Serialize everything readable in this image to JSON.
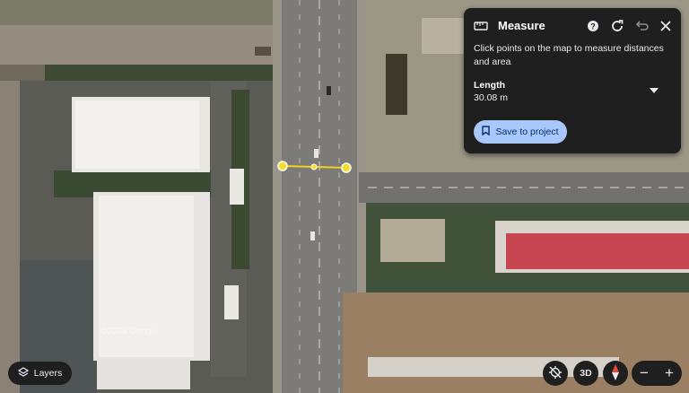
{
  "measure_panel": {
    "title": "Measure",
    "instructions": "Click points on the map to measure distances and area",
    "length_label": "Length",
    "length_value": "30.08 m",
    "save_label": "Save to project",
    "icons": [
      "ruler-icon",
      "help-icon",
      "refresh-icon",
      "undo-icon",
      "close-icon",
      "dropdown-arrow-icon",
      "bookmark-icon"
    ]
  },
  "map": {
    "watermark": "©2024 Google",
    "measure_line_color": "#f2d31b"
  },
  "controls": {
    "layers_label": "Layers",
    "view_3d_label": "3D",
    "zoom_out_label": "−",
    "zoom_in_label": "+"
  },
  "colors": {
    "panel_bg": "#1f1f1f",
    "save_button_bg": "#a8c7fa",
    "red_roof": "#c6454f"
  }
}
